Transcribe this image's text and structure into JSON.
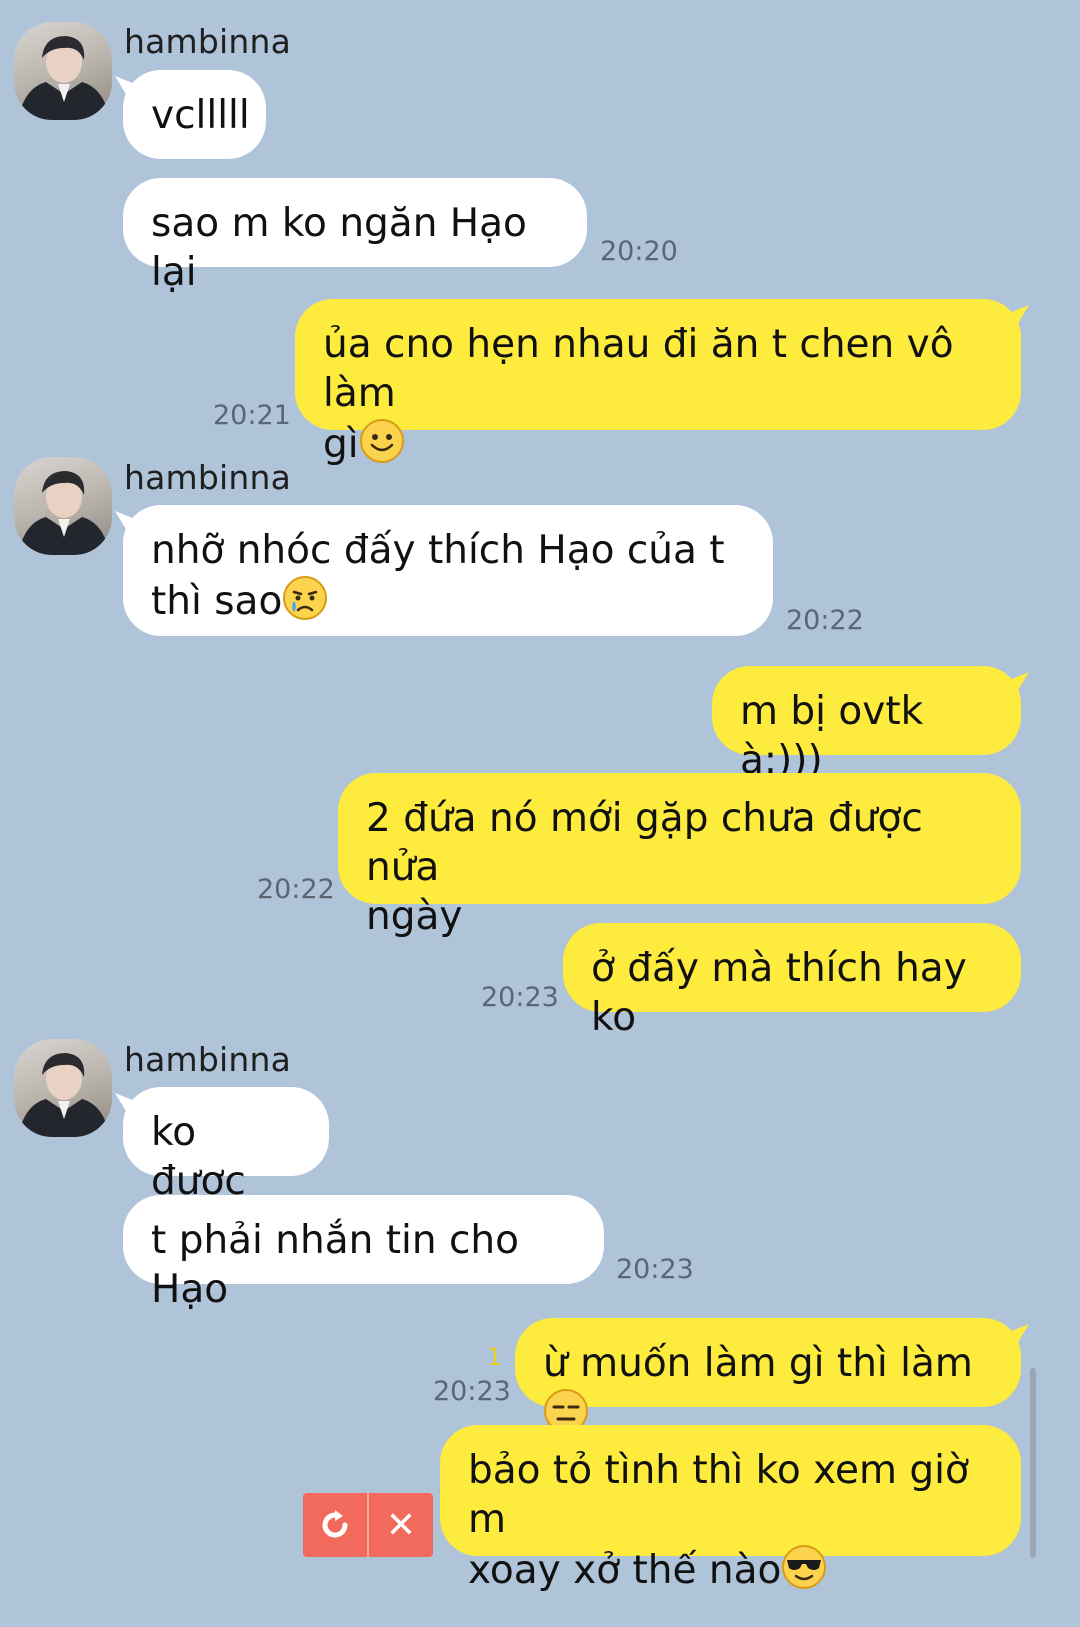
{
  "conversation": {
    "groups": [
      {
        "sender": "hambinna",
        "messages": [
          {
            "text": "vclllll"
          },
          {
            "text": "sao m ko ngăn Hạo lại",
            "time": "20:20"
          }
        ]
      },
      {
        "own": true,
        "messages": [
          {
            "text_line1": "ủa cno hẹn nhau đi ăn t chen vô làm",
            "text_line2": "gì",
            "emoji": "smile",
            "time": "20:21"
          }
        ]
      },
      {
        "sender": "hambinna",
        "messages": [
          {
            "text_line1": "nhỡ nhóc đấy thích Hạo của t",
            "text_line2": "thì sao",
            "emoji": "crying",
            "time": "20:22"
          }
        ]
      },
      {
        "own": true,
        "messages": [
          {
            "text": "m bị ovtk à:)))"
          },
          {
            "text_line1": "2 đứa nó mới gặp chưa được nửa",
            "text_line2": "ngày",
            "time": "20:22"
          },
          {
            "text": "ở đấy mà thích hay ko",
            "time": "20:23"
          }
        ]
      },
      {
        "sender": "hambinna",
        "messages": [
          {
            "text": "ko được"
          },
          {
            "text": "t phải nhắn tin cho Hạo",
            "time": "20:23"
          }
        ]
      },
      {
        "own": true,
        "messages": [
          {
            "text": "ừ muốn làm gì thì làm",
            "emoji": "expressionless",
            "unread": "1",
            "time": "20:23"
          },
          {
            "text_line1": "bảo tỏ tình thì ko xem giờ m",
            "text_line2": "xoay xở thế nào",
            "emoji": "sunglasses"
          }
        ]
      }
    ]
  },
  "failed_send": {
    "resend_icon": "resend-icon",
    "delete_icon": "close-icon",
    "delete_glyph": "✕"
  },
  "colors": {
    "background": "#b0c4d9",
    "incoming_bubble": "#ffffff",
    "outgoing_bubble": "#fdeb3e",
    "failed_send": "#f26a5b"
  }
}
